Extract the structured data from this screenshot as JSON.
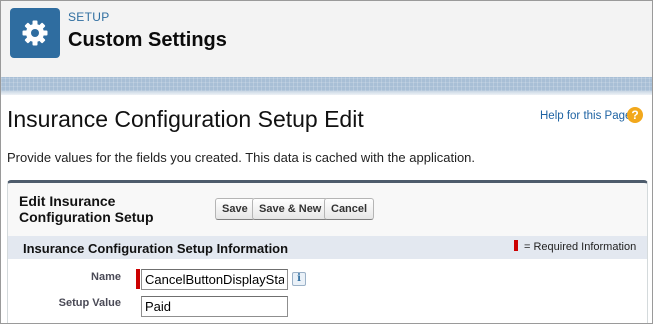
{
  "header": {
    "kicker": "SETUP",
    "title": "Custom Settings",
    "icon": "gear-icon",
    "icon_bg": "#2f6da0"
  },
  "page": {
    "title": "Insurance Configuration Setup Edit",
    "help_link": "Help for this Page",
    "help_icon": "?",
    "description": "Provide values for the fields you created. This data is cached with the application."
  },
  "panel": {
    "title": "Edit Insurance Configuration Setup",
    "buttons": {
      "save": "Save",
      "save_new": "Save & New",
      "cancel": "Cancel"
    },
    "section_title": "Insurance Configuration Setup Information",
    "required_legend": "= Required Information",
    "fields": {
      "name": {
        "label": "Name",
        "value": "CancelButtonDisplayStatus",
        "required": true
      },
      "setup_value": {
        "label": "Setup Value",
        "value": "Paid"
      }
    },
    "info_icon": "i"
  },
  "colors": {
    "accent": "#2f6ea0",
    "required": "#cc0000",
    "help_icon": "#f2a81c"
  }
}
